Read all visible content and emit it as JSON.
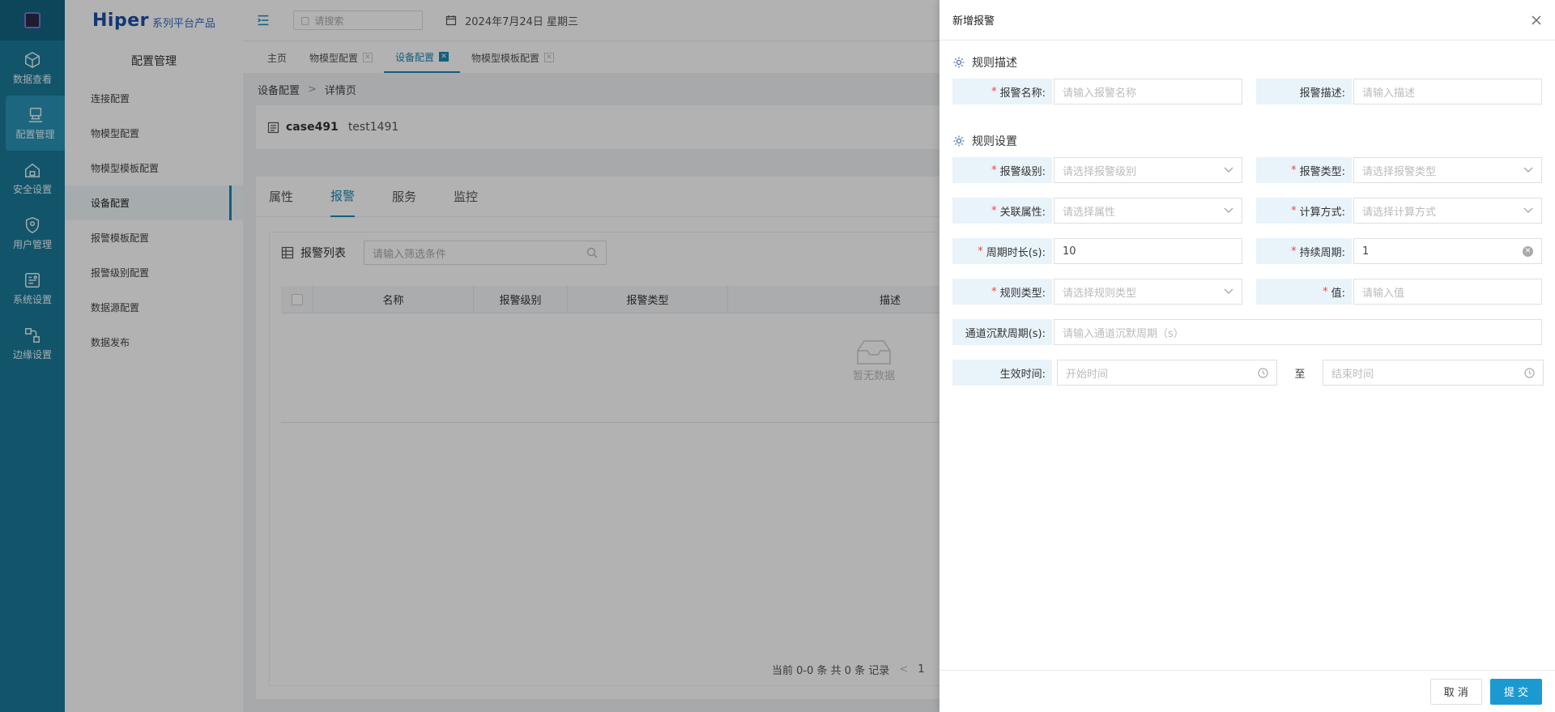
{
  "rail": {
    "items": [
      {
        "label": "数据查看",
        "icon": "cube-icon"
      },
      {
        "label": "配置管理",
        "icon": "config-icon"
      },
      {
        "label": "安全设置",
        "icon": "home-lock-icon"
      },
      {
        "label": "用户管理",
        "icon": "shield-icon"
      },
      {
        "label": "系统设置",
        "icon": "system-icon"
      },
      {
        "label": "边缘设置",
        "icon": "edge-icon"
      }
    ]
  },
  "brand": {
    "name": "Hiper",
    "sub": "系列平台产品"
  },
  "menu": {
    "title": "配置管理",
    "items": [
      "连接配置",
      "物模型配置",
      "物模型模板配置",
      "设备配置",
      "报警模板配置",
      "报警级别配置",
      "数据源配置",
      "数据发布"
    ]
  },
  "topbar": {
    "search_placeholder": "请搜索",
    "date": "2024年7月24日 星期三"
  },
  "tabs": [
    "主页",
    "物模型配置",
    "设备配置",
    "物模型模板配置"
  ],
  "breadcrumb": {
    "root": "设备配置",
    "sep": ">",
    "current": "详情页"
  },
  "device": {
    "code": "case491",
    "name": "test1491"
  },
  "content_tabs": [
    "属性",
    "报警",
    "服务",
    "监控"
  ],
  "alarm_list": {
    "title": "报警列表",
    "filter_placeholder": "请输入筛选条件",
    "columns": [
      "名称",
      "报警级别",
      "报警类型",
      "描述"
    ],
    "empty": "暂无数据",
    "pager": {
      "summary": "当前 0-0 条 共 0 条 记录",
      "page": "1"
    }
  },
  "drawer": {
    "title": "新增报警",
    "section1": "规则描述",
    "section2": "规则设置",
    "fields": {
      "alarm_name": {
        "label": "报警名称:",
        "placeholder": "请输入报警名称"
      },
      "alarm_desc": {
        "label": "报警描述:",
        "placeholder": "请输入描述"
      },
      "alarm_level": {
        "label": "报警级别:",
        "placeholder": "请选择报警级别"
      },
      "alarm_type": {
        "label": "报警类型:",
        "placeholder": "请选择报警类型"
      },
      "linked_attr": {
        "label": "关联属性:",
        "placeholder": "请选择属性"
      },
      "calc_mode": {
        "label": "计算方式:",
        "placeholder": "请选择计算方式"
      },
      "period": {
        "label": "周期时长(s):",
        "value": "10"
      },
      "duration": {
        "label": "持续周期:",
        "value": "1"
      },
      "rule_type": {
        "label": "规则类型:",
        "placeholder": "请选择规则类型"
      },
      "value": {
        "label": "值:",
        "placeholder": "请输入值"
      },
      "silence": {
        "label": "通道沉默周期(s):",
        "placeholder": "请输入通道沉默周期（s）"
      },
      "effective": {
        "label": "生效时间:",
        "start_placeholder": "开始时间",
        "to": "至",
        "end_placeholder": "结束时间"
      }
    },
    "cancel": "取 消",
    "submit": "提 交"
  },
  "colors": {
    "rail": "#1b7a9a",
    "accent": "#1b88b5",
    "submit": "#1b9ad1",
    "label_bg": "#e8f3fa",
    "required": "#ee4444"
  }
}
